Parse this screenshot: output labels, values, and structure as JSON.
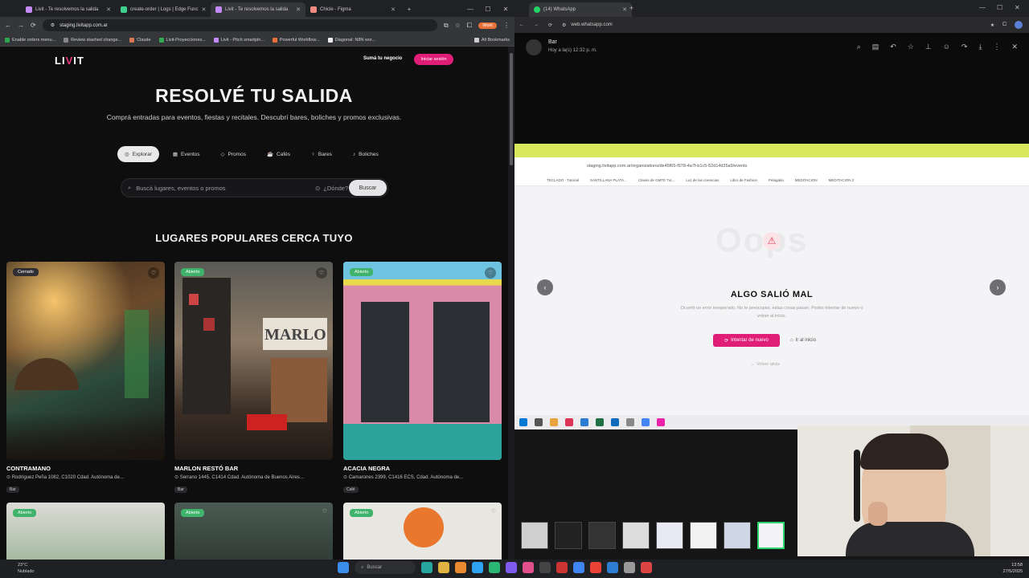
{
  "left_browser": {
    "tabs": [
      {
        "label": "Livit - Te resolvemos la salida",
        "color": "#c58af9"
      },
      {
        "label": "create-order | Logs | Edge Func",
        "color": "#8ab4f8"
      },
      {
        "label": "Livit - Te resolvemos la salida",
        "color": "#c58af9"
      },
      {
        "label": "Chicle - Figma",
        "color": "#f28b82"
      }
    ],
    "url": "staging.livitapp.com.ar",
    "profile": "Work",
    "bookmarks": [
      "Enable orders menu...",
      "Review stashed change...",
      "Claude",
      "Livit-Proyecciones...",
      "Livit - Pitch smartpin...",
      "Powerful Workflow...",
      "Diagonal: N8N wor..."
    ],
    "all_bookmarks": "All Bookmarks"
  },
  "site": {
    "logo": "LIVIT",
    "nav_link": "Sumá tu negocio",
    "login": "Iniciar sesión",
    "hero": "RESOLVÉ TU SALIDA",
    "subtitle": "Comprá entradas para eventos, fiestas y recitales. Descubrí bares, boliches y promos exclusivas.",
    "chips": [
      {
        "label": "Explorar",
        "icon": "compass-icon"
      },
      {
        "label": "Eventos",
        "icon": "calendar-icon"
      },
      {
        "label": "Promos",
        "icon": "tag-icon"
      },
      {
        "label": "Cafés",
        "icon": "coffee-icon"
      },
      {
        "label": "Bares",
        "icon": "glass-icon"
      },
      {
        "label": "Boliches",
        "icon": "music-icon"
      }
    ],
    "search_placeholder": "Buscá lugares, eventos o promos",
    "where_placeholder": "¿Dónde?",
    "search_button": "Buscar",
    "section_title": "LUGARES POPULARES CERCA TUYO",
    "cards": [
      {
        "name": "CONTRAMANO",
        "address": "Rodríguez Peña 1082, C1020 Cdad. Autónoma de...",
        "tag": "Bar",
        "status": "Cerrado",
        "status_color": "#2f2f33"
      },
      {
        "name": "MARLON RESTÓ BAR",
        "address": "Serrano 1445, C1414 Cdad. Autónoma de Buenos Aires...",
        "tag": "Bar",
        "status": "Abierto",
        "status_color": "#3fb36b"
      },
      {
        "name": "ACACIA NEGRA",
        "address": "Camarones 2399, C1416 ECS, Cdad. Autónoma de...",
        "tag": "Café",
        "status": "Abierto",
        "status_color": "#3fb36b"
      }
    ],
    "second_row_status": [
      "Abierto",
      "Abierto",
      "Abierto"
    ]
  },
  "right_browser": {
    "tab": "(14) WhatsApp",
    "url": "web.whatsapp.com",
    "contact": "Bar",
    "contact_time": "Hoy a la(s) 12:32 p. m.",
    "inner_url": "staging.livitapp.com.ar/organizations/de45f65-f978-4a7f-b1c5-52d14d35a9/events",
    "inner_bookmarks": [
      "TECLADO - Tutorial",
      "SANTILLANA PLATA...",
      "Clases de GMTE Tut...",
      "Luz de las creencias",
      "Libro de Fashion",
      "Pelagatia",
      "MEDITACION",
      "MEDITACION 2"
    ],
    "oops": "Oops",
    "error_title": "ALGO SALIÓ MAL",
    "error_text": "Ocurrió un error inesperado. No te preocupes, estas cosas pasan. Podés intentar de nuevo o volver al inicio.",
    "retry": "Intentar de nuevo",
    "home": "Ir al inicio",
    "back": "Volver atrás"
  },
  "taskbar": {
    "weather_temp": "23°C",
    "weather_desc": "Nublado",
    "search": "Buscar",
    "time": "13:58",
    "date": "27/5/2025"
  }
}
